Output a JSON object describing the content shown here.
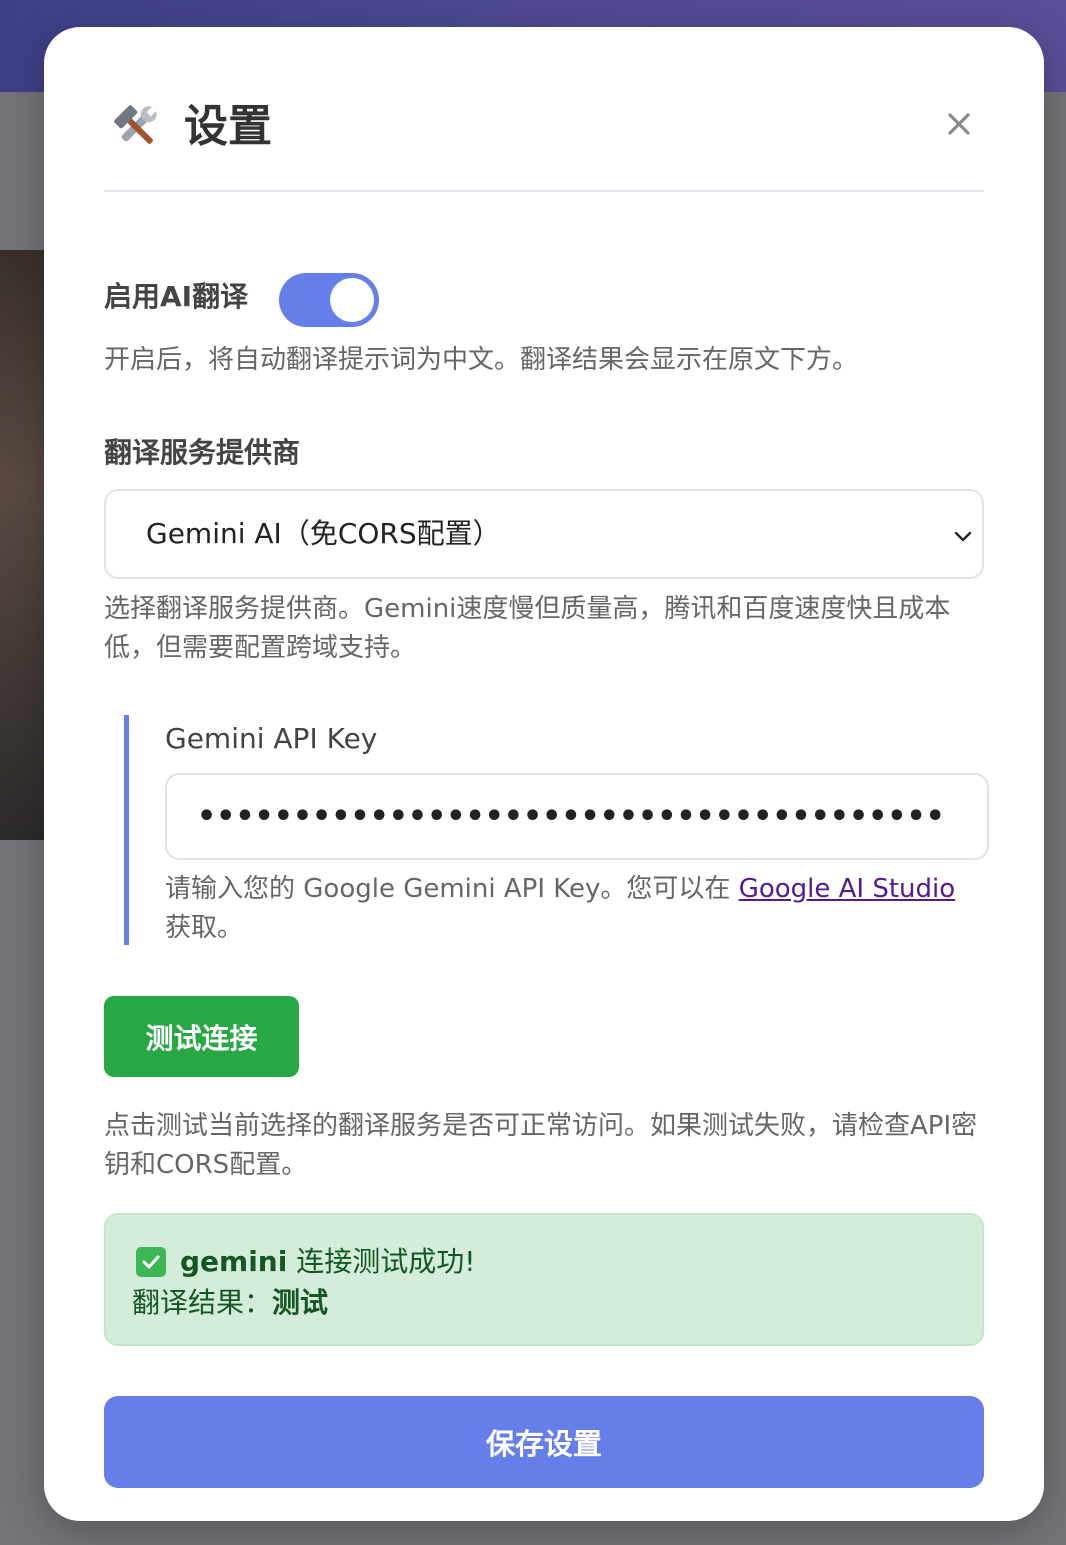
{
  "modal": {
    "title": "设置",
    "title_icon": "hammer-and-wrench-icon",
    "close_icon": "close-icon"
  },
  "enable_ai": {
    "label": "启用AI翻译",
    "enabled": true,
    "help": "开启后，将自动翻译提示词为中文。翻译结果会显示在原文下方。"
  },
  "provider": {
    "label": "翻译服务提供商",
    "selected": "Gemini AI（免CORS配置）",
    "help": "选择翻译服务提供商。Gemini速度慢但质量高，腾讯和百度速度快且成本低，但需要配置跨域支持。"
  },
  "api_key": {
    "label": "Gemini API Key",
    "value": "•••••••••••••••••••••••••••••••••••••••",
    "help_prefix": "请输入您的 Google Gemini API Key。您可以在 ",
    "help_link": "Google AI Studio",
    "help_suffix": " 获取。"
  },
  "test": {
    "button_label": "测试连接",
    "help": "点击测试当前选择的翻译服务是否可正常访问。如果测试失败，请检查API密钥和CORS配置。"
  },
  "result": {
    "service": "gemini",
    "message": " 连接测试成功!",
    "translation_label": "翻译结果：",
    "translation_value": "测试"
  },
  "save_button_label": "保存设置",
  "colors": {
    "accent": "#667eea",
    "success_button": "#28a745",
    "success_bg": "#d4edda",
    "success_text": "#155724"
  }
}
